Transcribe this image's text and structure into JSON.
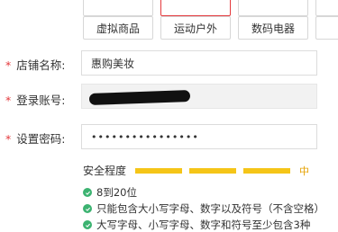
{
  "category_chips": {
    "top_row": [
      {
        "label": "",
        "active": false
      },
      {
        "label": "",
        "active": true
      },
      {
        "label": "",
        "active": false
      }
    ],
    "row": [
      "虚拟商品",
      "运动户外",
      "数码电器"
    ]
  },
  "form": {
    "shop_name": {
      "label": "店铺名称:",
      "value": "惠购美妆"
    },
    "login_account": {
      "label": "登录账号:",
      "value": ""
    },
    "password": {
      "label": "设置密码:",
      "value": "••••••••••••••••"
    }
  },
  "strength": {
    "label": "安全程度",
    "level": "中"
  },
  "rules": [
    "8到20位",
    "只能包含大小写字母、数字以及符号（不含空格）",
    "大写字母、小写字母、数字和符号至少包含3种"
  ],
  "colors": {
    "required": "#e4393c",
    "strength_bar": "#f5c518",
    "check": "#3cb371"
  }
}
